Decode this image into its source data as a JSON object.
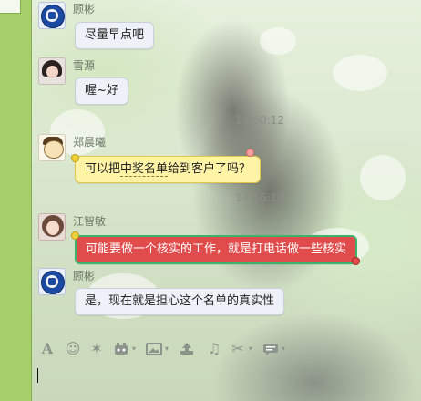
{
  "messages": [
    {
      "sender": "顾彬",
      "text": "尽量早点吧"
    },
    {
      "sender": "雪源",
      "text": "喔~好",
      "time": "14:50:12"
    },
    {
      "sender": "郑晨曦",
      "text_before": "可以把",
      "text_dashed": "中奖名单",
      "text_after": "给到客户了吗？",
      "time": "14:56:19"
    },
    {
      "sender": "江智敏",
      "text": "可能要做一个核实的工作，就是打电话做一些核实"
    },
    {
      "sender": "顾彬",
      "text": "是，现在就是担心这个名单的真实性"
    }
  ],
  "toolbar": {
    "font": "A",
    "emoji": "☺",
    "shake": "✶",
    "screenshot_tool": "✂",
    "music": "♫",
    "caret": "▾"
  },
  "colors": {
    "left_bar": "#a6cf6a",
    "yellow_bubble": "#fff3a6",
    "red_bubble": "#e04b4b",
    "green_border": "#3bb36a"
  }
}
